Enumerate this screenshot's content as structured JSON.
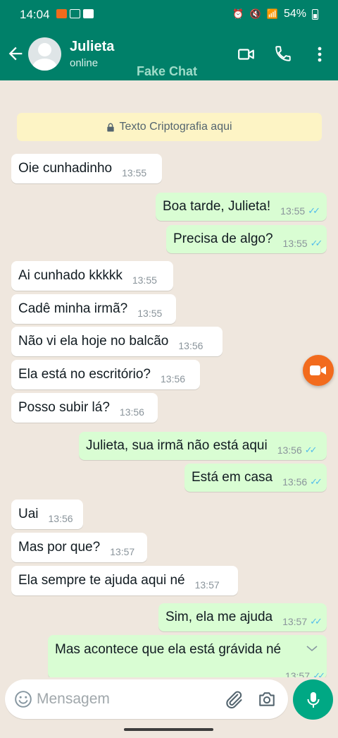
{
  "status_bar": {
    "time": "14:04",
    "battery": "54%"
  },
  "header": {
    "contact_name": "Julieta",
    "contact_status": "online",
    "watermark": "Fake Chat"
  },
  "encryption_notice": "Texto Criptografia aqui",
  "messages": [
    {
      "direction": "in",
      "text": "Oie cunhadinho",
      "time": "13:55"
    },
    {
      "direction": "out",
      "text": "Boa tarde, Julieta!",
      "time": "13:55"
    },
    {
      "direction": "out",
      "text": "Precisa de algo?",
      "time": "13:55"
    },
    {
      "direction": "in",
      "text": "Ai cunhado kkkkk",
      "time": "13:55"
    },
    {
      "direction": "in",
      "text": "Cadê minha irmã?",
      "time": "13:55"
    },
    {
      "direction": "in",
      "text": "Não vi ela hoje no balcão",
      "time": "13:56"
    },
    {
      "direction": "in",
      "text": "Ela está no escritório?",
      "time": "13:56"
    },
    {
      "direction": "in",
      "text": "Posso subir lá?",
      "time": "13:56"
    },
    {
      "direction": "out",
      "text": "Julieta, sua irmã não está aqui",
      "time": "13:56"
    },
    {
      "direction": "out",
      "text": "Está em casa",
      "time": "13:56"
    },
    {
      "direction": "in",
      "text": "Uai",
      "time": "13:56"
    },
    {
      "direction": "in",
      "text": "Mas por que?",
      "time": "13:57"
    },
    {
      "direction": "in",
      "text": "Ela sempre te ajuda aqui né",
      "time": "13:57"
    },
    {
      "direction": "out",
      "text": "Sim, ela me ajuda",
      "time": "13:57"
    },
    {
      "direction": "out",
      "text": "Mas acontece que ela está grávida né",
      "time": "13:57"
    }
  ],
  "composer": {
    "placeholder": "Mensagem"
  },
  "colors": {
    "header": "#008069",
    "incoming_bubble": "#ffffff",
    "outgoing_bubble": "#d9fdd3",
    "chat_background": "#efe7de",
    "read_ticks": "#53bdeb",
    "send_button": "#00a884",
    "record_button": "#f26b1d"
  }
}
